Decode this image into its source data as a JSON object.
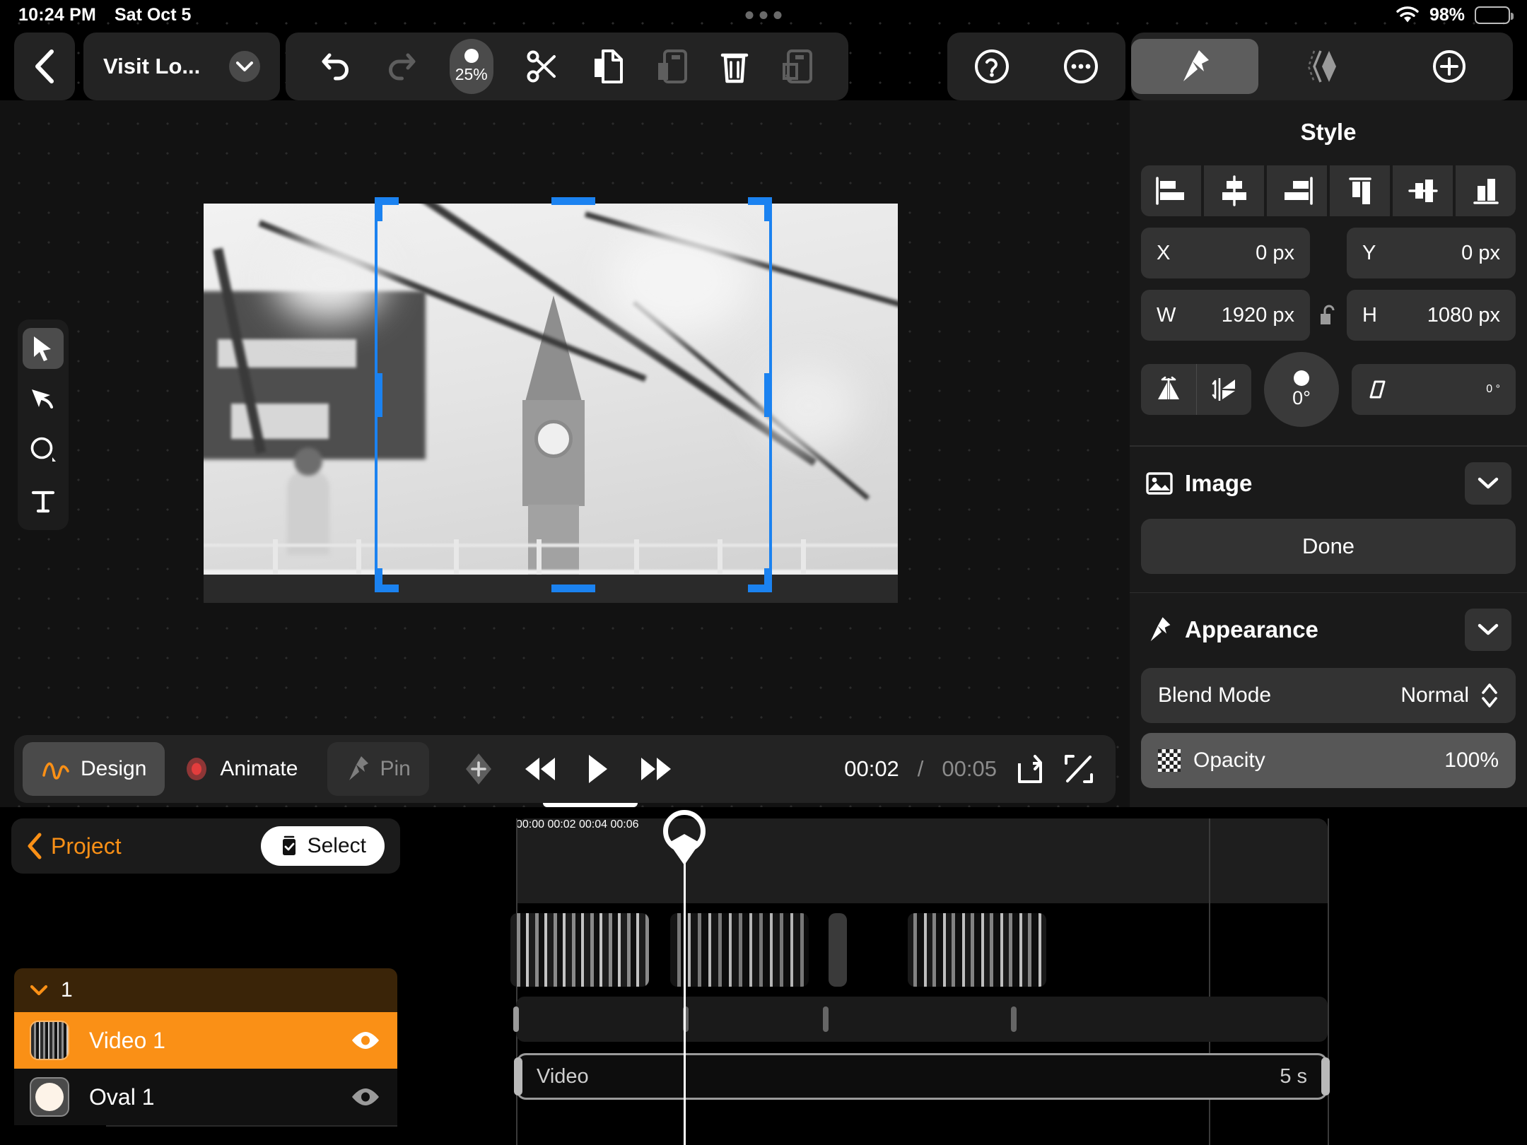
{
  "status_bar": {
    "time": "10:24 PM",
    "date": "Sat Oct 5",
    "battery_percent": "98%",
    "wifi_icon": "wifi-icon",
    "battery_icon": "battery-icon"
  },
  "toolbar": {
    "back_icon": "chevron-left-icon",
    "project_title": "Visit Lo...",
    "title_chevron_icon": "chevron-down-icon",
    "undo_icon": "undo-icon",
    "redo_icon": "redo-icon",
    "zoom_level": "25%",
    "cut_icon": "scissors-icon",
    "copy_icon": "copy-icon",
    "paste_icon": "paste-icon",
    "delete_icon": "trash-icon",
    "duplicate_icon": "duplicate-icon",
    "help_icon": "question-mark-icon",
    "more_icon": "ellipsis-icon",
    "style_tab_icon": "pin-brush-icon",
    "layers_tab_icon": "layers-icon",
    "add_tab_icon": "plus-circle-icon"
  },
  "tools": [
    {
      "name": "select-tool",
      "icon": "cursor-arrow-icon",
      "active": true
    },
    {
      "name": "path-tool",
      "icon": "pen-cursor-icon",
      "active": false
    },
    {
      "name": "shape-tool",
      "icon": "ellipse-icon",
      "active": false
    },
    {
      "name": "text-tool",
      "icon": "text-t-icon",
      "active": false
    }
  ],
  "style_panel": {
    "title": "Style",
    "align_buttons": [
      "align-left-icon",
      "align-center-horizontal-icon",
      "align-right-icon",
      "align-top-icon",
      "align-center-vertical-icon",
      "align-bottom-icon"
    ],
    "x_label": "X",
    "x_value": "0 px",
    "y_label": "Y",
    "y_value": "0 px",
    "w_label": "W",
    "w_value": "1920 px",
    "h_label": "H",
    "h_value": "1080 px",
    "lock_icon": "unlocked-padlock-icon",
    "flip_horizontal_icon": "flip-horizontal-icon",
    "flip_vertical_icon": "flip-vertical-icon",
    "rotation_value": "0°",
    "skew_icon": "skew-icon",
    "skew_value": "0 °",
    "image_section": {
      "icon": "image-icon",
      "title": "Image",
      "collapse_icon": "chevron-down-icon",
      "done_label": "Done"
    },
    "appearance_section": {
      "icon": "pin-brush-icon",
      "title": "Appearance",
      "collapse_icon": "chevron-down-icon",
      "blend_mode_label": "Blend Mode",
      "blend_mode_value": "Normal",
      "blend_mode_stepper_icon": "chevron-up-down-icon",
      "opacity_icon": "checkerboard-icon",
      "opacity_label": "Opacity",
      "opacity_value": "100%"
    }
  },
  "playback_bar": {
    "design_label": "Design",
    "design_icon": "squiggle-icon",
    "animate_label": "Animate",
    "animate_icon": "record-dot-icon",
    "pin_label": "Pin",
    "pin_icon": "pin-icon",
    "keyframe_icon": "keyframe-diamond-icon",
    "rewind_icon": "rewind-icon",
    "play_icon": "play-icon",
    "forward_icon": "fast-forward-icon",
    "current_time": "00:02",
    "time_separator": "/",
    "total_time": "00:05",
    "loop_icon": "loop-icon",
    "fullscreen_icon": "expand-icon"
  },
  "layers_panel": {
    "back_icon": "chevron-left-icon",
    "back_label": "Project",
    "select_label": "Select",
    "select_icon": "checklist-icon",
    "group": {
      "chevron_icon": "chevron-down-icon",
      "name": "1"
    },
    "items": [
      {
        "name": "Video 1",
        "thumb": "video-thumbnail",
        "visibility_icon": "eye-icon",
        "selected": true
      },
      {
        "name": "Oval 1",
        "thumb": "oval-thumbnail",
        "visibility_icon": "eye-icon",
        "selected": false
      }
    ]
  },
  "timeline": {
    "ruler_labels": [
      "00:00",
      "00:02",
      "00:04",
      "00:06"
    ],
    "playhead_time": "00:02",
    "clip": {
      "name": "Video",
      "duration": "5 s"
    }
  },
  "canvas": {
    "artboard_label": "video-frame-big-ben",
    "selection_handles": "blue-selection-frame"
  },
  "colors": {
    "accent_orange": "#fa9016",
    "selection_blue": "#1b82f0",
    "panel_bg": "#1a1a1a",
    "toolbar_bg": "#232323",
    "record_red": "#d94242"
  }
}
